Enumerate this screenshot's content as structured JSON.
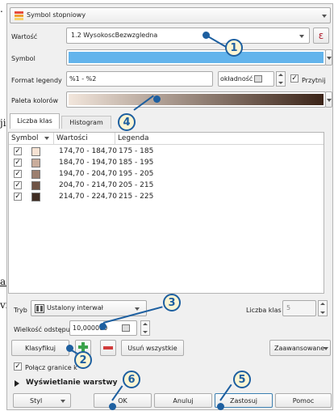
{
  "background_fragments": {
    "top_dot": ".",
    "mid_left": "ji",
    "lower_a": "a.",
    "lower_vi": "vi,"
  },
  "header_combo": {
    "label": "Symbol stopniowy"
  },
  "wartosc": {
    "label": "Wartość",
    "value": "1.2  WysokoscBezwzgledna",
    "expr_button": "ε"
  },
  "symbol": {
    "label": "Symbol",
    "color": "#63b4ec"
  },
  "format_legendy": {
    "label": "Format legendy",
    "value": "%1 - %2",
    "precision_label": "okładność (",
    "trim_label": "Przytnij",
    "trim_checked": true
  },
  "paleta": {
    "label": "Paleta kolorów",
    "gradient_start": "#f2e6dc",
    "gradient_end": "#3b2418"
  },
  "tabs": [
    {
      "label": "Liczba klas",
      "active": true
    },
    {
      "label": "Histogram",
      "active": false
    }
  ],
  "table": {
    "headers": [
      "Symbol",
      "Wartości",
      "Legenda"
    ],
    "rows": [
      {
        "checked": true,
        "color": "#f6e2d3",
        "values": "174,70 - 184,70",
        "legend": "175 - 185"
      },
      {
        "checked": true,
        "color": "#c9ad9c",
        "values": "184,70 - 194,70",
        "legend": "185 - 195"
      },
      {
        "checked": true,
        "color": "#9c7f6f",
        "values": "194,70 - 204,70",
        "legend": "195 - 205"
      },
      {
        "checked": true,
        "color": "#6f5446",
        "values": "204,70 - 214,70",
        "legend": "205 - 215"
      },
      {
        "checked": true,
        "color": "#3f2c22",
        "values": "214,70 - 224,70",
        "legend": "215 - 225"
      }
    ]
  },
  "tryb": {
    "label": "Tryb",
    "value": "Ustalony interwał"
  },
  "liczba_klas": {
    "label": "Liczba klas",
    "value": "5"
  },
  "wielkosc": {
    "label": "Wielkość odstępu",
    "value": "10,000000"
  },
  "buttons": {
    "klasyfikuj": "Klasyfikuj",
    "usun_wszystkie": "Usuń wszystkie",
    "zaawansowane": "Zaawansowane",
    "polacz": "Połącz granice k",
    "polacz_checked": true,
    "wyswietlanie": "Wyświetlanie warstwy",
    "styl": "Styl",
    "ok": "OK",
    "anuluj": "Anuluj",
    "zastosuj": "Zastosuj",
    "pomoc": "Pomoc"
  },
  "callouts": [
    "1",
    "2",
    "3",
    "4",
    "5",
    "6"
  ]
}
